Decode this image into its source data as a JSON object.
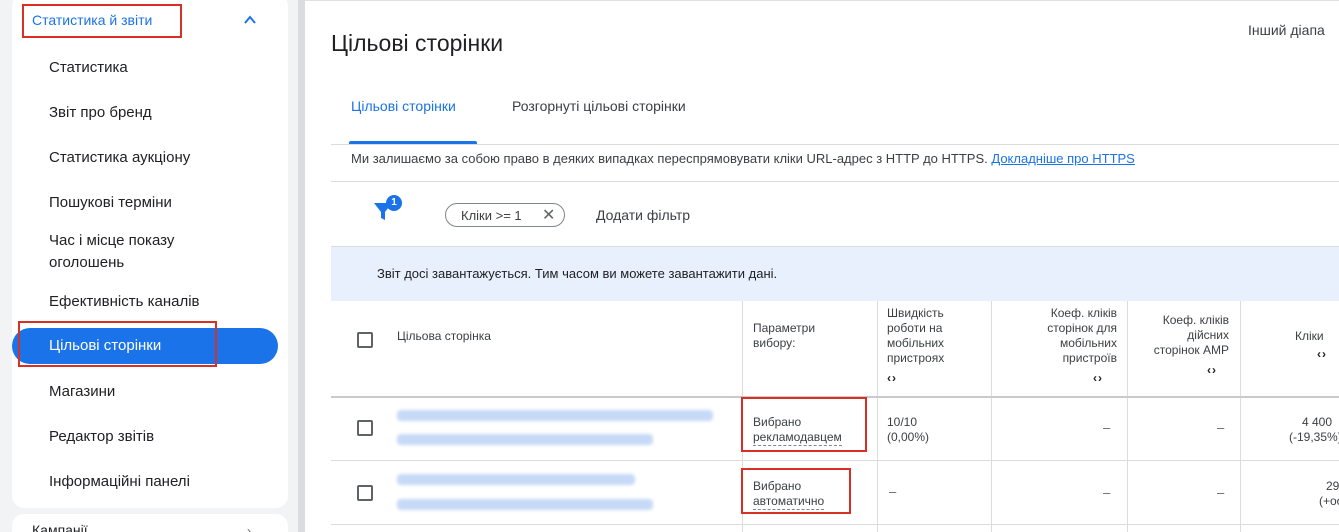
{
  "sidebar": {
    "section_title": "Статистика й звіти",
    "items": [
      {
        "label": "Статистика"
      },
      {
        "label": "Звіт про бренд"
      },
      {
        "label": "Статистика аукціону"
      },
      {
        "label": "Пошукові терміни"
      },
      {
        "label": "Час і місце показу оголошень"
      },
      {
        "label": "Ефективність каналів"
      },
      {
        "label": "Цільові сторінки",
        "active": true
      },
      {
        "label": "Магазини"
      },
      {
        "label": "Редактор звітів"
      },
      {
        "label": "Інформаційні панелі"
      }
    ],
    "next_section": "Кампанії"
  },
  "header": {
    "title": "Цільові сторінки",
    "date_range_label": "Інший діапа"
  },
  "tabs": [
    {
      "label": "Цільові сторінки",
      "active": true
    },
    {
      "label": "Розгорнуті цільові сторінки",
      "active": false
    }
  ],
  "notice": {
    "text": "Ми залишаємо за собою право в деяких випадках переспрямовувати кліки URL-адрес з HTTP до HTTPS.",
    "link": "Докладніше про HTTPS"
  },
  "filters": {
    "badge_count": "1",
    "chip_label": "Кліки >= 1",
    "add_filter": "Додати фільтр"
  },
  "banner": {
    "text": "Звіт досі завантажується. Тим часом ви можете завантажити дані."
  },
  "table": {
    "columns": [
      {
        "label": "Цільова сторінка"
      },
      {
        "label": "Параметри вибору:"
      },
      {
        "label": "Швидкість роботи на мобільних пристроях"
      },
      {
        "label": "Коеф. кліків сторінок для мобільних пристроїв"
      },
      {
        "label": "Коеф. кліків дійсних сторінок AMP"
      },
      {
        "label": "Кліки"
      }
    ],
    "sort_glyph": "‹›",
    "rows": [
      {
        "selection": "Вибрано рекламодавцем",
        "selection_line1": "Вибрано",
        "selection_line2": "рекламодавцем",
        "speed": "10/10",
        "speed_change": "(0,00%)",
        "mobile_ctr": "–",
        "amp_ctr": "–",
        "clicks": "4 400",
        "clicks_change": "(-19,35%)"
      },
      {
        "selection": "Вибрано автоматично",
        "selection_line1": "Вибрано",
        "selection_line2": "автоматично",
        "speed": "–",
        "mobile_ctr": "–",
        "amp_ctr": "–",
        "clicks": "29",
        "clicks_change": "(+oo"
      }
    ]
  },
  "colors": {
    "accent": "#1a73e8",
    "highlight": "#d93025",
    "banner_bg": "#e8f0fe"
  }
}
